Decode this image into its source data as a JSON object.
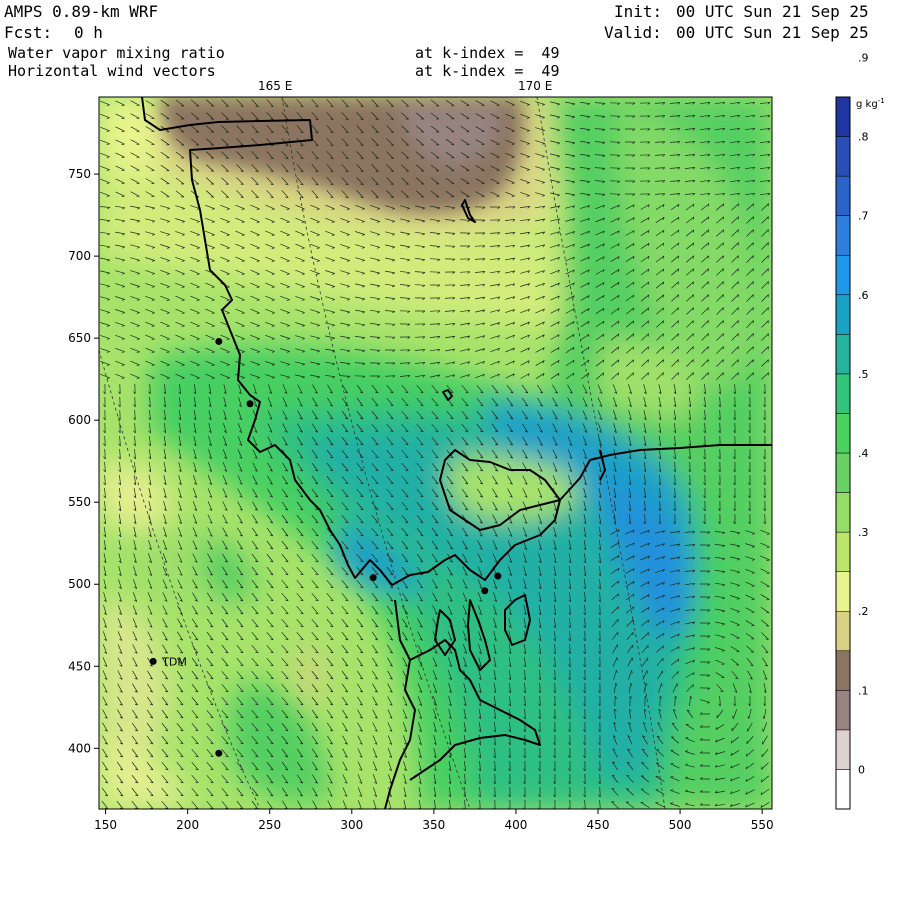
{
  "header": {
    "model": "AMPS 0.89-km WRF",
    "fcst_label": "Fcst:",
    "fcst_value": "0 h",
    "init_label": "Init:",
    "init_value": "00 UTC Sun 21 Sep 25",
    "valid_label": "Valid:",
    "valid_value": "00 UTC Sun 21 Sep 25"
  },
  "fields": [
    {
      "name": "Water vapor mixing ratio",
      "level": "at k-index =  49"
    },
    {
      "name": "Horizontal wind vectors",
      "level": "at k-index =  49"
    }
  ],
  "longitude_labels": [
    "165 E",
    "170 E"
  ],
  "station_label": "TDM",
  "chart_data": {
    "type": "heatmap",
    "x_ticks": [
      150,
      200,
      250,
      300,
      350,
      400,
      450,
      500,
      550
    ],
    "y_ticks": [
      400,
      450,
      500,
      550,
      600,
      650,
      700,
      750
    ],
    "xlim": [
      146,
      556
    ],
    "ylim": [
      363,
      797
    ],
    "colorbar": {
      "unit": "g kg",
      "unit_exp": "-1",
      "labels": [
        "0",
        ".1",
        ".2",
        ".3",
        ".4",
        ".5",
        ".6",
        ".7",
        ".8",
        ".9"
      ],
      "colors": [
        "#ffffff",
        "#dcd2d0",
        "#978380",
        "#8b7462",
        "#d8d183",
        "#e8f48c",
        "#bce56c",
        "#95dd68",
        "#68d364",
        "#4ad160",
        "#33c57c",
        "#26b39e",
        "#1aa2c6",
        "#1f98ea",
        "#2e7fe0",
        "#2a63c9",
        "#2a4fb4",
        "#1f36a0"
      ]
    },
    "stations": [
      {
        "x": 219,
        "y": 648,
        "label": ""
      },
      {
        "x": 238,
        "y": 610,
        "label": ""
      },
      {
        "x": 313,
        "y": 504,
        "label": ""
      },
      {
        "x": 381,
        "y": 496,
        "label": ""
      },
      {
        "x": 389,
        "y": 505,
        "label": ""
      },
      {
        "x": 179,
        "y": 453,
        "label": "TDM"
      },
      {
        "x": 219,
        "y": 397,
        "label": ""
      }
    ]
  }
}
